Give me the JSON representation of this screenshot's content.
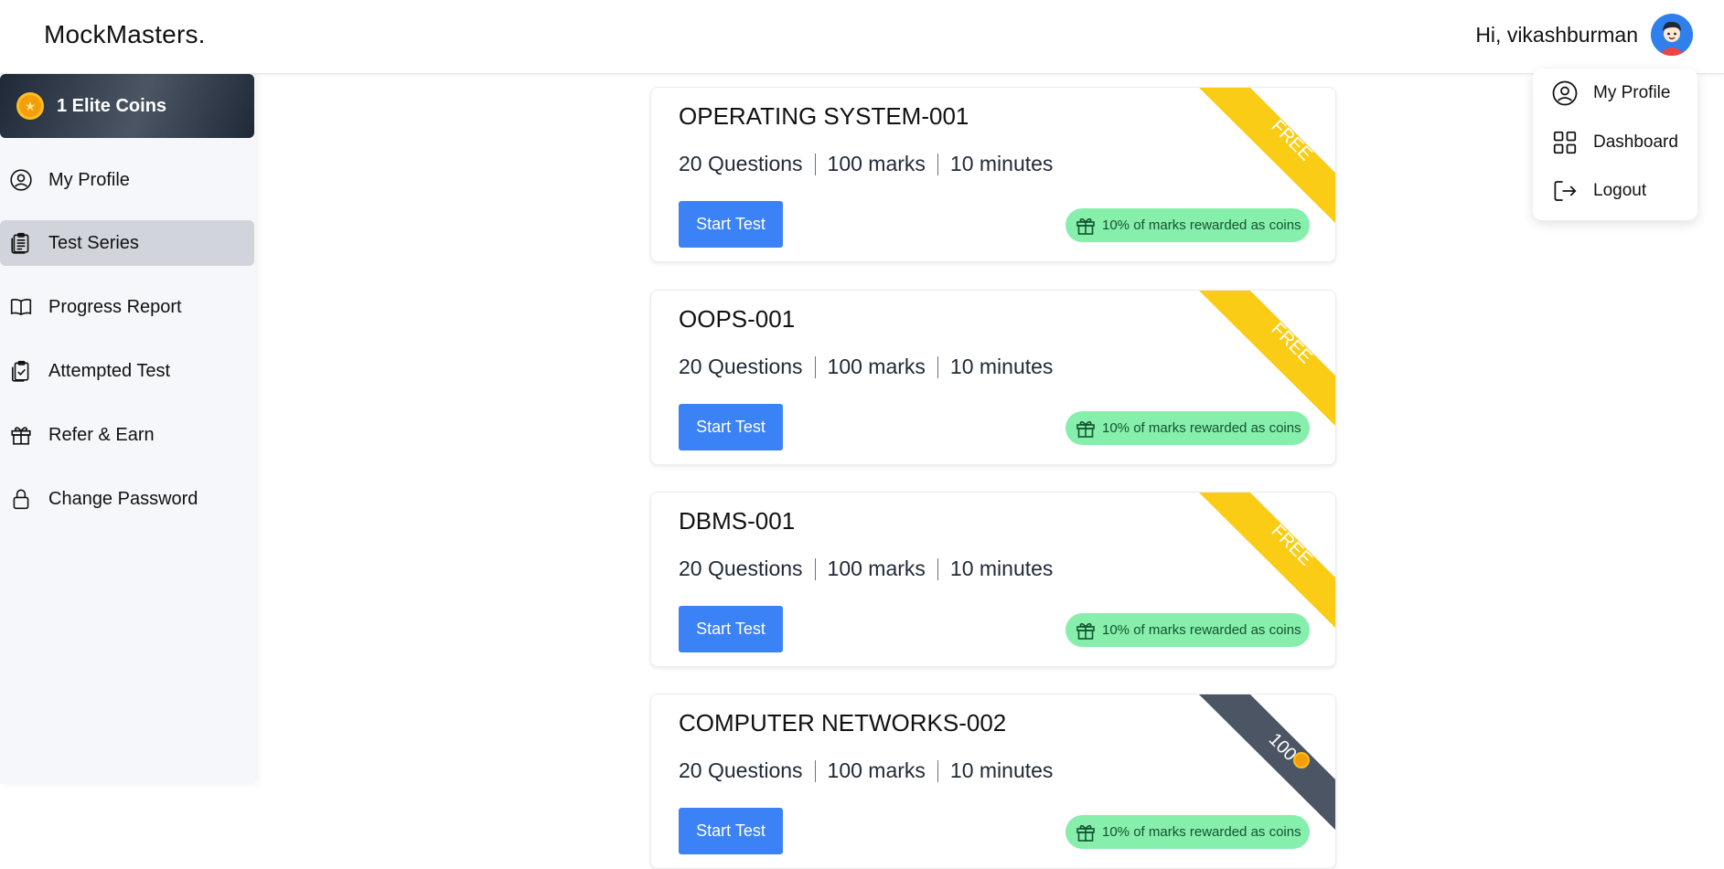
{
  "header": {
    "logo": "MockMasters.",
    "greeting": "Hi, vikashburman"
  },
  "dropdown": {
    "items": [
      {
        "label": "My Profile",
        "icon": "user-circle-icon"
      },
      {
        "label": "Dashboard",
        "icon": "grid-icon"
      },
      {
        "label": "Logout",
        "icon": "logout-icon"
      }
    ]
  },
  "sidebar": {
    "coins_label": "1 Elite Coins",
    "items": [
      {
        "label": "My Profile",
        "icon": "user-circle-icon"
      },
      {
        "label": "Test Series",
        "icon": "clipboard-list-icon",
        "active": true
      },
      {
        "label": "Progress Report",
        "icon": "open-book-icon"
      },
      {
        "label": "Attempted Test",
        "icon": "clipboard-check-icon"
      },
      {
        "label": "Refer & Earn",
        "icon": "gift-icon"
      },
      {
        "label": "Change Password",
        "icon": "lock-icon"
      }
    ]
  },
  "tests": [
    {
      "title": "OPERATING SYSTEM-001",
      "questions": "20 Questions",
      "marks": "100 marks",
      "duration": "10 minutes",
      "button": "Start Test",
      "reward": "10% of marks rewarded as coins",
      "ribbon": "FREE"
    },
    {
      "title": "OOPS-001",
      "questions": "20 Questions",
      "marks": "100 marks",
      "duration": "10 minutes",
      "button": "Start Test",
      "reward": "10% of marks rewarded as coins",
      "ribbon": "FREE"
    },
    {
      "title": "DBMS-001",
      "questions": "20 Questions",
      "marks": "100 marks",
      "duration": "10 minutes",
      "button": "Start Test",
      "reward": "10% of marks rewarded as coins",
      "ribbon": "FREE"
    },
    {
      "title": "COMPUTER NETWORKS-002",
      "questions": "20 Questions",
      "marks": "100 marks",
      "duration": "10 minutes",
      "button": "Start Test",
      "reward": "10% of marks rewarded as coins",
      "ribbon": "100"
    }
  ],
  "colors": {
    "primary": "#3b82f6",
    "ribbon_free": "#facc15",
    "ribbon_paid": "#4b5563",
    "reward_bg": "#86efac"
  }
}
